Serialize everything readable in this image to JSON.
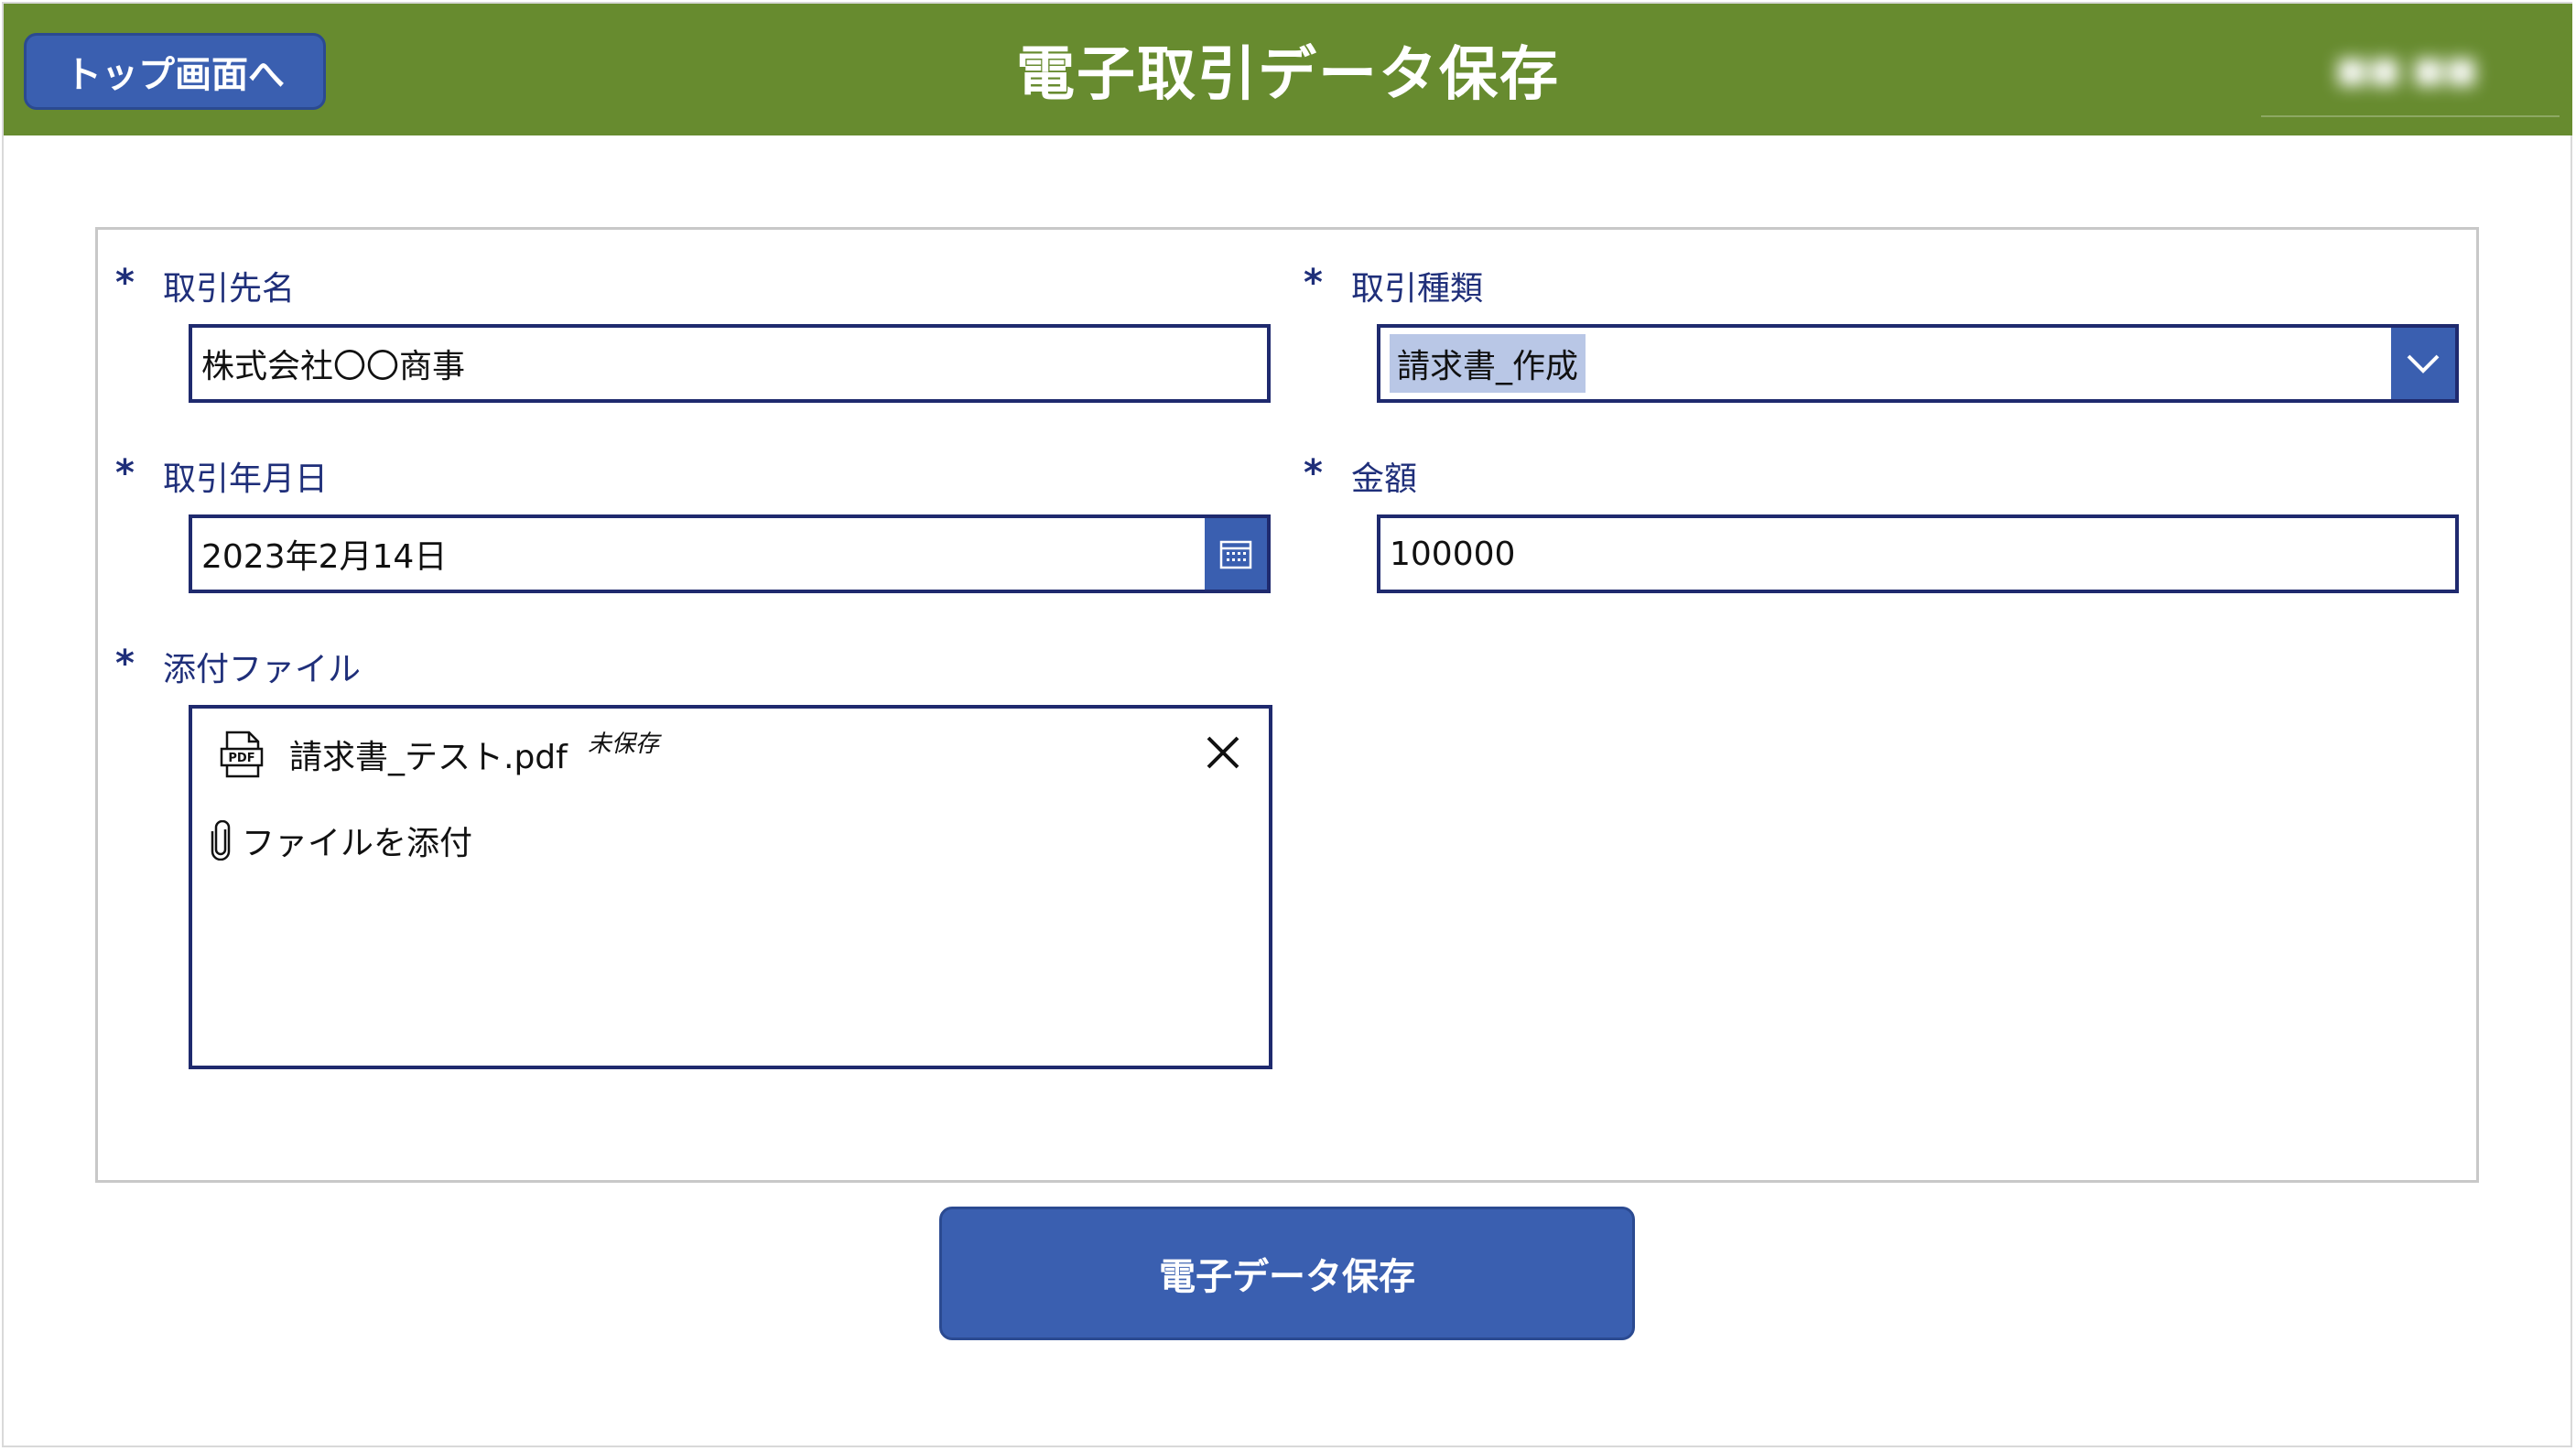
{
  "header": {
    "back_label": "トップ画面へ",
    "title": "電子取引データ保存",
    "user_name": "■■ ■■",
    "background_color": "#678b2f"
  },
  "form": {
    "required_mark": "*",
    "partner": {
      "label": "取引先名",
      "value": "株式会社〇〇商事"
    },
    "transaction_type": {
      "label": "取引種類",
      "value": "請求書_作成",
      "icon": "chevron-down-icon"
    },
    "date": {
      "label": "取引年月日",
      "value": "2023年2月14日",
      "icon": "calendar-icon"
    },
    "amount": {
      "label": "金額",
      "value": "100000"
    },
    "attachment": {
      "label": "添付ファイル",
      "file_name": "請求書_テスト.pdf",
      "file_status": "未保存",
      "file_icon": "pdf-icon",
      "remove_icon": "close-icon",
      "add_label": "ファイルを添付",
      "add_icon": "paperclip-icon"
    }
  },
  "save_button": {
    "label": "電子データ保存"
  },
  "colors": {
    "accent": "#3a5fb0",
    "border": "#1f2a6e",
    "label": "#1f2f7a",
    "chip": "#b9c7e6"
  }
}
